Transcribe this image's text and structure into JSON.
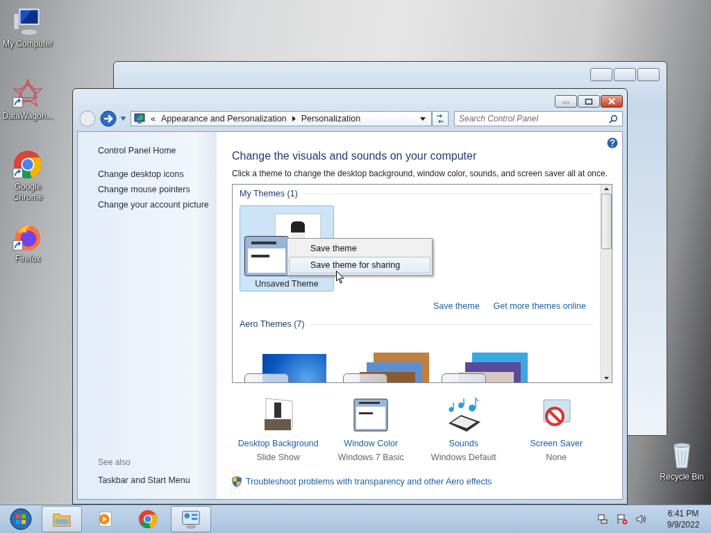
{
  "desktop_icons": [
    {
      "kind": "computer",
      "label": "My Computer",
      "shortcut": false
    },
    {
      "kind": "app",
      "label": "DataWagon...",
      "shortcut": true
    },
    {
      "kind": "chrome",
      "label": "Google Chrome",
      "shortcut": true
    },
    {
      "kind": "firefox",
      "label": "Firefox",
      "shortcut": true
    },
    {
      "kind": "recycle",
      "label": "Recycle Bin",
      "shortcut": false
    }
  ],
  "window": {
    "address": {
      "overflow_mark": "«",
      "breadcrumb": [
        "Appearance and Personalization",
        "Personalization"
      ]
    },
    "search": {
      "placeholder": "Search Control Panel"
    }
  },
  "sidebar": {
    "items": [
      "Control Panel Home",
      "Change desktop icons",
      "Change mouse pointers",
      "Change your account picture"
    ],
    "see_also": {
      "heading": "See also",
      "items": [
        "Taskbar and Start Menu"
      ]
    }
  },
  "main": {
    "heading": "Change the visuals and sounds on your computer",
    "description": "Click a theme to change the desktop background, window color, sounds, and screen saver all at once.",
    "theme_groups": [
      {
        "title": "My Themes (1)",
        "themes": [
          {
            "kind": "custom",
            "name": "Unsaved Theme",
            "selected": true
          }
        ]
      },
      {
        "title": "Aero Themes (7)",
        "themes": [
          {
            "kind": "windows",
            "selected": false
          },
          {
            "kind": "stack-warm",
            "selected": false
          },
          {
            "kind": "stack-flowers",
            "selected": false
          }
        ]
      }
    ],
    "theme_links": [
      "Save theme",
      "Get more themes online"
    ],
    "context_menu": {
      "items": [
        {
          "label": "Save theme",
          "selected": false
        },
        {
          "label": "Save theme for sharing",
          "selected": true
        }
      ]
    },
    "settings": [
      {
        "kind": "background",
        "label": "Desktop Background",
        "value": "Slide Show"
      },
      {
        "kind": "window-color",
        "label": "Window Color",
        "value": "Windows 7 Basic"
      },
      {
        "kind": "sounds",
        "label": "Sounds",
        "value": "Windows Default"
      },
      {
        "kind": "screensaver",
        "label": "Screen Saver",
        "value": "None"
      }
    ],
    "troubleshoot_link": "Troubleshoot problems with transparency and other Aero effects"
  },
  "taskbar": {
    "items": [
      {
        "kind": "explorer",
        "running": true
      },
      {
        "kind": "media",
        "running": false
      },
      {
        "kind": "chrome",
        "running": false
      },
      {
        "kind": "control-panel",
        "running": true
      }
    ],
    "time": "6:41 PM",
    "date": "9/9/2022"
  }
}
